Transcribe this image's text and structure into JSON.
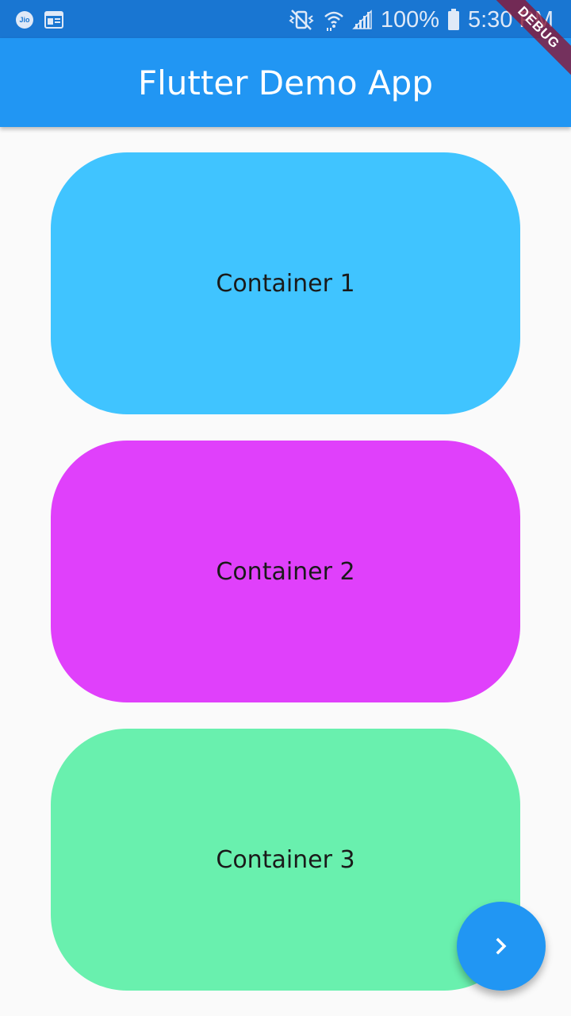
{
  "status_bar": {
    "carrier_icon_label": "Jio",
    "battery": "100%",
    "time": "5:30 PM",
    "icons": [
      "jio-icon",
      "news-icon",
      "mute-vibrate-icon",
      "wifi-icon",
      "signal-icon",
      "battery-icon"
    ],
    "background_color": "#1976d2"
  },
  "debug_banner": {
    "label": "DEBUG"
  },
  "app_bar": {
    "title": "Flutter Demo App",
    "background_color": "#2196f3"
  },
  "containers": [
    {
      "label": "Container 1",
      "color": "#40c4ff"
    },
    {
      "label": "Container 2",
      "color": "#e040fb"
    },
    {
      "label": "Container 3",
      "color": "#69f0ae"
    }
  ],
  "fab": {
    "icon": "chevron-right-icon",
    "color": "#2196f3"
  }
}
